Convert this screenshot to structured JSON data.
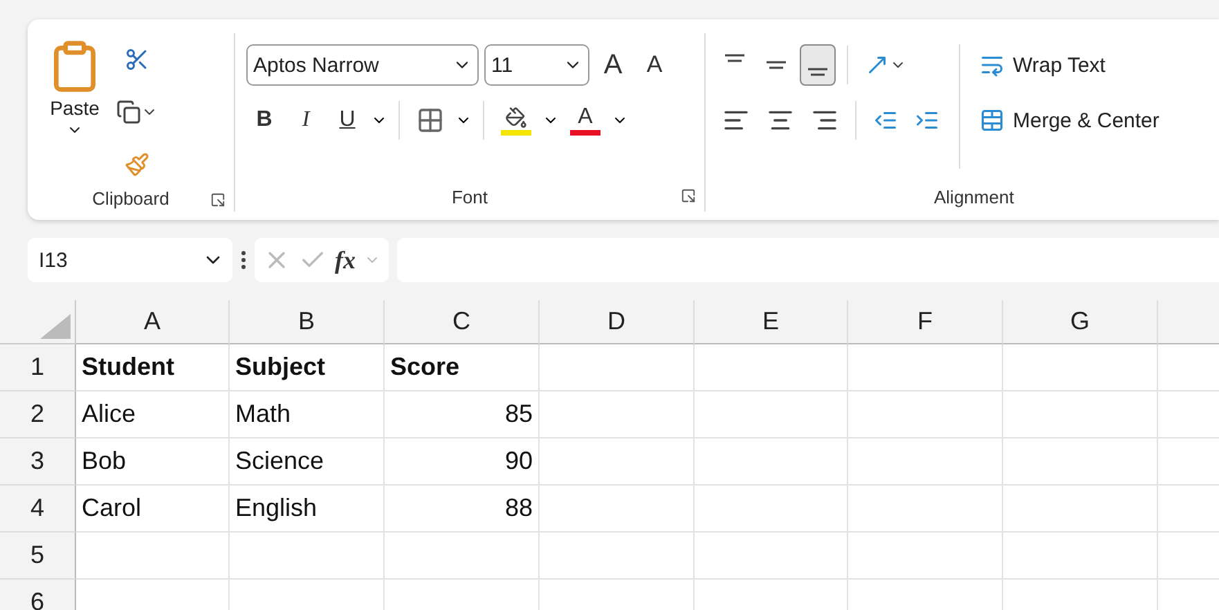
{
  "ribbon": {
    "clipboard": {
      "paste_label": "Paste",
      "group_label": "Clipboard"
    },
    "font": {
      "font_name": "Aptos Narrow",
      "font_size": "11",
      "grow_glyph": "A",
      "shrink_glyph": "A",
      "bold_glyph": "B",
      "italic_glyph": "I",
      "underline_glyph": "U",
      "color_glyph": "A",
      "group_label": "Font"
    },
    "alignment": {
      "vertical_buttons": [
        {
          "kind": "top",
          "selected": false
        },
        {
          "kind": "middle",
          "selected": false
        },
        {
          "kind": "bottom",
          "selected": true
        }
      ],
      "horizontal_buttons": [
        {
          "kind": "left",
          "selected": false
        },
        {
          "kind": "center",
          "selected": false
        },
        {
          "kind": "right",
          "selected": false
        }
      ],
      "wrap_text": "Wrap Text",
      "merge_center": "Merge & Center",
      "group_label": "Alignment"
    }
  },
  "formula_bar": {
    "name_box": "I13",
    "fx": "fx"
  },
  "sheet": {
    "columns": [
      {
        "label": "A",
        "kind": "text"
      },
      {
        "label": "B",
        "kind": "text"
      },
      {
        "label": "C",
        "kind": "number"
      },
      {
        "label": "D",
        "kind": "text"
      },
      {
        "label": "E",
        "kind": "text"
      },
      {
        "label": "F",
        "kind": "text"
      },
      {
        "label": "G",
        "kind": "text"
      }
    ],
    "rows": [
      {
        "number": "1",
        "kind": "header",
        "cells": [
          "Student",
          "Subject",
          "Score"
        ]
      },
      {
        "number": "2",
        "kind": "data",
        "cells": [
          "Alice",
          "Math",
          "85"
        ]
      },
      {
        "number": "3",
        "kind": "data",
        "cells": [
          "Bob",
          "Science",
          "90"
        ]
      },
      {
        "number": "4",
        "kind": "data",
        "cells": [
          "Carol",
          "English",
          "88"
        ]
      },
      {
        "number": "5",
        "kind": "data"
      },
      {
        "number": "6",
        "kind": "data"
      }
    ]
  }
}
